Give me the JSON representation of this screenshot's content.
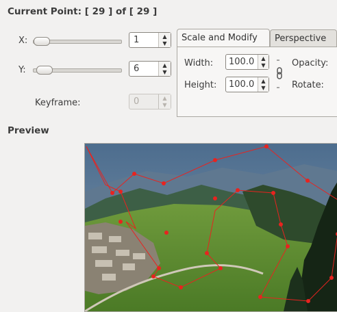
{
  "header": {
    "label": "Current Point: [ 29 ] of [ 29 ]"
  },
  "point": {
    "x_label": "X:",
    "x_value": "1",
    "y_label": "Y:",
    "y_value": "6",
    "keyframe_label": "Keyframe:",
    "keyframe_value": "0"
  },
  "tabs": [
    {
      "label": "Scale and Modify",
      "active": true
    },
    {
      "label": "Perspective",
      "active": false
    }
  ],
  "scale_modify": {
    "width_label": "Width:",
    "width_value": "100.0",
    "height_label": "Height:",
    "height_value": "100.0",
    "opacity_label": "Opacity:",
    "rotate_label": "Rotate:"
  },
  "preview": {
    "label": "Preview"
  },
  "colors": {
    "path_red": "#e8231f",
    "window_bg": "#f2f1f0"
  },
  "icons": {
    "chain": "chain-link-icon",
    "spin_up": "chevron-up-icon",
    "spin_down": "chevron-down-icon"
  }
}
